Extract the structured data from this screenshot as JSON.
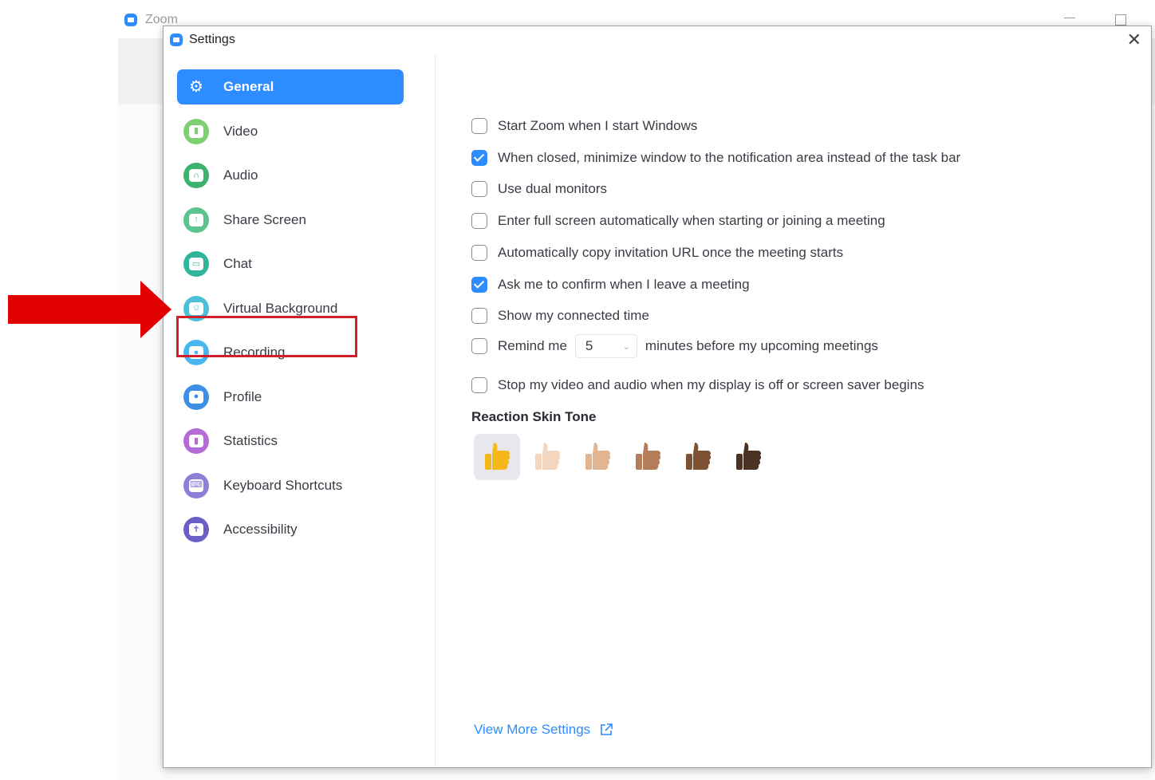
{
  "background_window": {
    "title": "Zoom"
  },
  "dialog": {
    "title": "Settings",
    "close_label": "✕"
  },
  "sidebar": {
    "items": [
      {
        "label": "General",
        "icon": "gear-icon",
        "color": "#2d8cff",
        "active": true
      },
      {
        "label": "Video",
        "icon": "video-icon",
        "color": "#7fcf73",
        "active": false
      },
      {
        "label": "Audio",
        "icon": "headphones-icon",
        "color": "#3fb36d",
        "active": false
      },
      {
        "label": "Share Screen",
        "icon": "share-screen-icon",
        "color": "#5cc58e",
        "active": false
      },
      {
        "label": "Chat",
        "icon": "chat-icon",
        "color": "#2fb59b",
        "active": false
      },
      {
        "label": "Virtual Background",
        "icon": "virtual-background-icon",
        "color": "#4cc0d8",
        "active": false
      },
      {
        "label": "Recording",
        "icon": "recording-icon",
        "color": "#4ab6ef",
        "active": false
      },
      {
        "label": "Profile",
        "icon": "profile-icon",
        "color": "#3d8fe6",
        "active": false
      },
      {
        "label": "Statistics",
        "icon": "statistics-icon",
        "color": "#b46bd6",
        "active": false
      },
      {
        "label": "Keyboard Shortcuts",
        "icon": "keyboard-icon",
        "color": "#8c7fd8",
        "active": false
      },
      {
        "label": "Accessibility",
        "icon": "accessibility-icon",
        "color": "#6b5fc7",
        "active": false
      }
    ]
  },
  "general": {
    "options": [
      {
        "label": "Start Zoom when I start Windows",
        "checked": false
      },
      {
        "label": "When closed, minimize window to the notification area instead of the task bar",
        "checked": true
      },
      {
        "label": "Use dual monitors",
        "checked": false
      },
      {
        "label": "Enter full screen automatically when starting or joining a meeting",
        "checked": false
      },
      {
        "label": "Automatically copy invitation URL once the meeting starts",
        "checked": false
      },
      {
        "label": "Ask me to confirm when I leave a meeting",
        "checked": true
      },
      {
        "label": "Show my connected time",
        "checked": false
      }
    ],
    "remind": {
      "label": "Remind me",
      "value": "5",
      "suffix": "minutes before my upcoming meetings",
      "checked": false
    },
    "stop_video": {
      "label": "Stop my video and audio when my display is off or screen saver begins",
      "checked": false
    },
    "reaction_skin_tone": {
      "title": "Reaction Skin Tone",
      "tones": [
        {
          "icon": "thumbs-up-yellow-icon",
          "color": "#f5b819",
          "selected": true
        },
        {
          "icon": "thumbs-up-light-icon",
          "color": "#f3d6bd",
          "selected": false
        },
        {
          "icon": "thumbs-up-medium-light-icon",
          "color": "#e2b48f",
          "selected": false
        },
        {
          "icon": "thumbs-up-medium-icon",
          "color": "#b47d5a",
          "selected": false
        },
        {
          "icon": "thumbs-up-medium-dark-icon",
          "color": "#7d5232",
          "selected": false
        },
        {
          "icon": "thumbs-up-dark-icon",
          "color": "#4a3224",
          "selected": false
        }
      ]
    },
    "view_more": "View More Settings"
  },
  "annotation": {
    "arrow_color": "#e00000",
    "highlight_color": "#d0202a"
  }
}
